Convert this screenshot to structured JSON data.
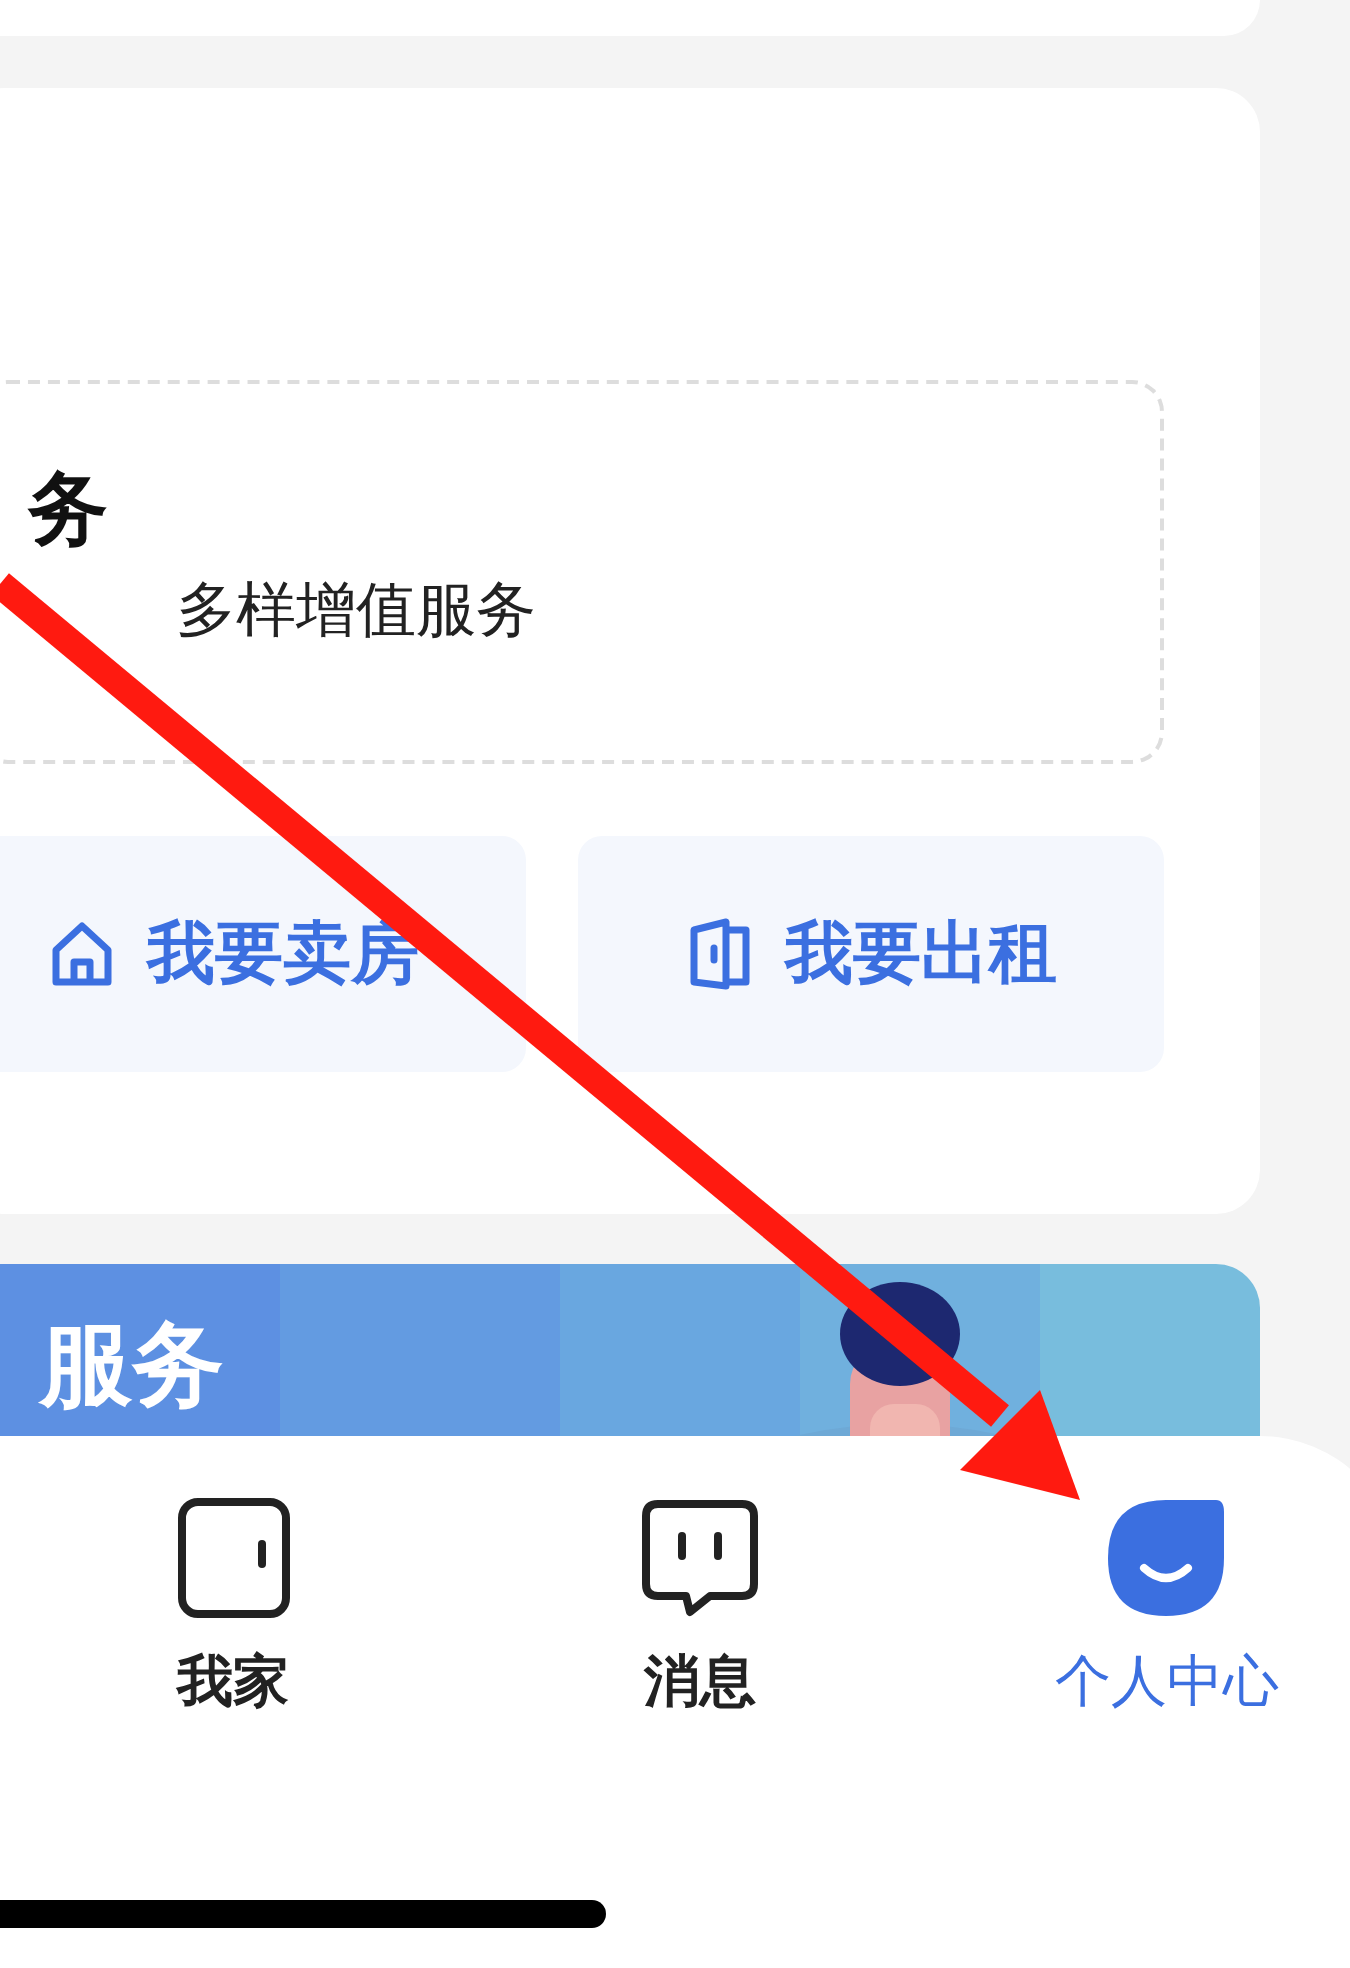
{
  "service_card": {
    "title": "务",
    "subtitle": "多样增值服务",
    "actions": [
      {
        "label": "我要卖房"
      },
      {
        "label": "我要出租"
      }
    ]
  },
  "banner": {
    "title": "服务"
  },
  "tab_bar": {
    "tabs": [
      {
        "label": "我家",
        "selected": false
      },
      {
        "label": "消息",
        "selected": false
      },
      {
        "label": "个人中心",
        "selected": true
      }
    ]
  },
  "annotation": {
    "kind": "arrow"
  }
}
